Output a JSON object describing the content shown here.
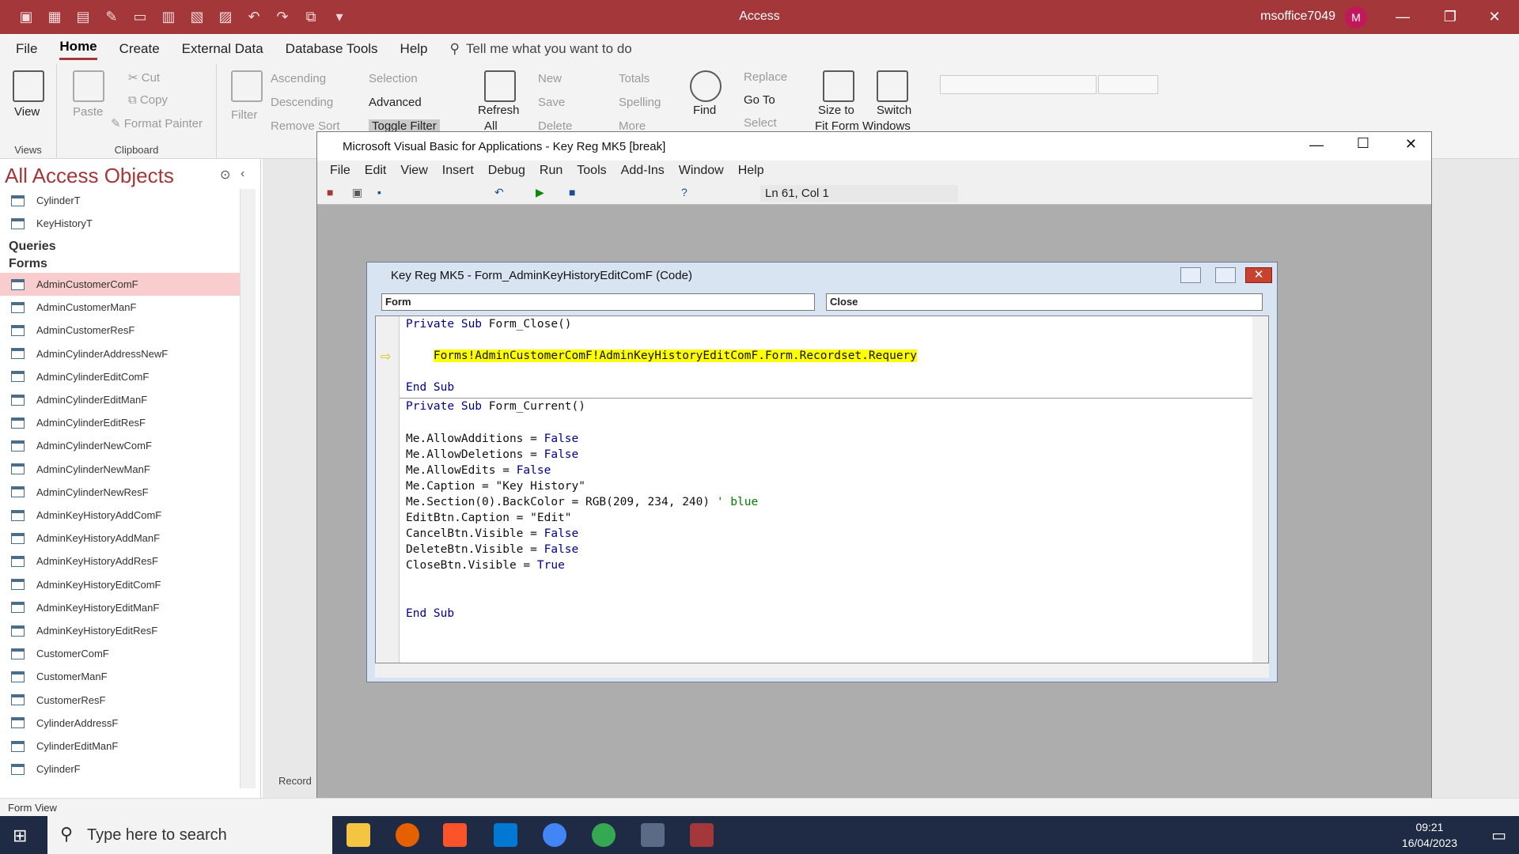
{
  "titlebar": {
    "app": "Access",
    "user": "msoffice7049",
    "avatar_letter": "M"
  },
  "menu": {
    "file": "File",
    "home": "Home",
    "create": "Create",
    "external": "External Data",
    "dbtools": "Database Tools",
    "help": "Help",
    "tellme": "Tell me what you want to do"
  },
  "ribbon": {
    "view": "View",
    "views_group": "Views",
    "paste": "Paste",
    "cut": "Cut",
    "copy": "Copy",
    "format_painter": "Format Painter",
    "clipboard_group": "Clipboard",
    "filter": "Filter",
    "ascending": "Ascending",
    "descending": "Descending",
    "remove_sort": "Remove Sort",
    "selection": "Selection",
    "advanced": "Advanced",
    "toggle_filter": "Toggle Filter",
    "refresh": "Refresh",
    "refresh_all": "All",
    "new": "New",
    "save": "Save",
    "delete": "Delete",
    "totals": "Totals",
    "spelling": "Spelling",
    "more": "More",
    "find": "Find",
    "replace": "Replace",
    "goto": "Go To",
    "select": "Select",
    "size_fit": "Size to",
    "size_fit2": "Fit Form",
    "switch": "Switch",
    "switch2": "Windows"
  },
  "nav": {
    "title": "All Access Objects",
    "queries": "Queries",
    "forms": "Forms",
    "tables": [
      "CylinderT",
      "KeyHistoryT"
    ],
    "form_items": [
      "AdminCustomerComF",
      "AdminCustomerManF",
      "AdminCustomerResF",
      "AdminCylinderAddressNewF",
      "AdminCylinderEditComF",
      "AdminCylinderEditManF",
      "AdminCylinderEditResF",
      "AdminCylinderNewComF",
      "AdminCylinderNewManF",
      "AdminCylinderNewResF",
      "AdminKeyHistoryAddComF",
      "AdminKeyHistoryAddManF",
      "AdminKeyHistoryAddResF",
      "AdminKeyHistoryEditComF",
      "AdminKeyHistoryEditManF",
      "AdminKeyHistoryEditResF",
      "CustomerComF",
      "CustomerManF",
      "CustomerResF",
      "CylinderAddressF",
      "CylinderEditManF",
      "CylinderF"
    ]
  },
  "status": {
    "left": "Form View",
    "record": "Record"
  },
  "vba": {
    "title": "Microsoft Visual Basic for Applications - Key Reg MK5 [break]",
    "menu": [
      "File",
      "Edit",
      "View",
      "Insert",
      "Debug",
      "Run",
      "Tools",
      "Add-Ins",
      "Window",
      "Help"
    ],
    "position": "Ln 61, Col 1"
  },
  "code": {
    "title": "Key Reg MK5 - Form_AdminKeyHistoryEditComF (Code)",
    "object_combo": "Form",
    "proc_combo": "Close",
    "lines": {
      "l1a": "Private Sub ",
      "l1b": "Form_Close()",
      "hl": "Forms!AdminCustomerComF!AdminKeyHistoryEditComF.Form.Recordset.Requery",
      "end1": "End Sub",
      "l2a": "Private Sub ",
      "l2b": "Form_Current()",
      "c1a": "Me.AllowAdditions = ",
      "c1b": "False",
      "c2a": "Me.AllowDeletions = ",
      "c2b": "False",
      "c3a": "Me.AllowEdits = ",
      "c3b": "False",
      "c4": "Me.Caption = \"Key History\"",
      "c5a": "Me.Section(0).BackColor = RGB(209, 234, 240) ",
      "c5b": "' blue",
      "c6": "EditBtn.Caption = \"Edit\"",
      "c7a": "CancelBtn.Visible = ",
      "c7b": "False",
      "c8a": "DeleteBtn.Visible = ",
      "c8b": "False",
      "c9a": "CloseBtn.Visible = ",
      "c9b": "True",
      "end2": "End Sub"
    }
  },
  "taskbar": {
    "search": "Type here to search",
    "time": "09:21",
    "date": "16/04/2023"
  }
}
